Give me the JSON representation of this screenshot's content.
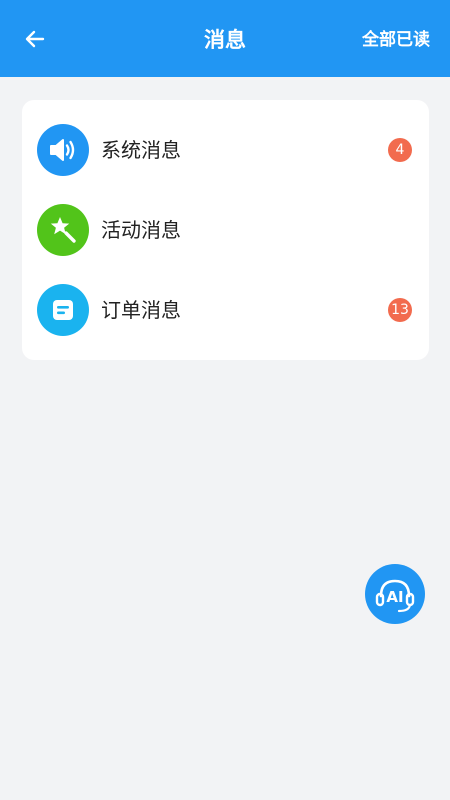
{
  "header": {
    "title": "消息",
    "mark_all_read": "全部已读"
  },
  "messages": [
    {
      "label": "系统消息",
      "badge": "4",
      "icon": "speaker-icon",
      "icon_color": "#2196f3"
    },
    {
      "label": "活动消息",
      "badge": "",
      "icon": "star-wand-icon",
      "icon_color": "#52c41a"
    },
    {
      "label": "订单消息",
      "badge": "13",
      "icon": "document-icon",
      "icon_color": "#1ab3ef"
    }
  ],
  "fab": {
    "label": "AI",
    "icon": "ai-headset-icon"
  },
  "colors": {
    "header": "#2196f3",
    "background": "#f2f3f5",
    "badge": "#f26b4e"
  }
}
